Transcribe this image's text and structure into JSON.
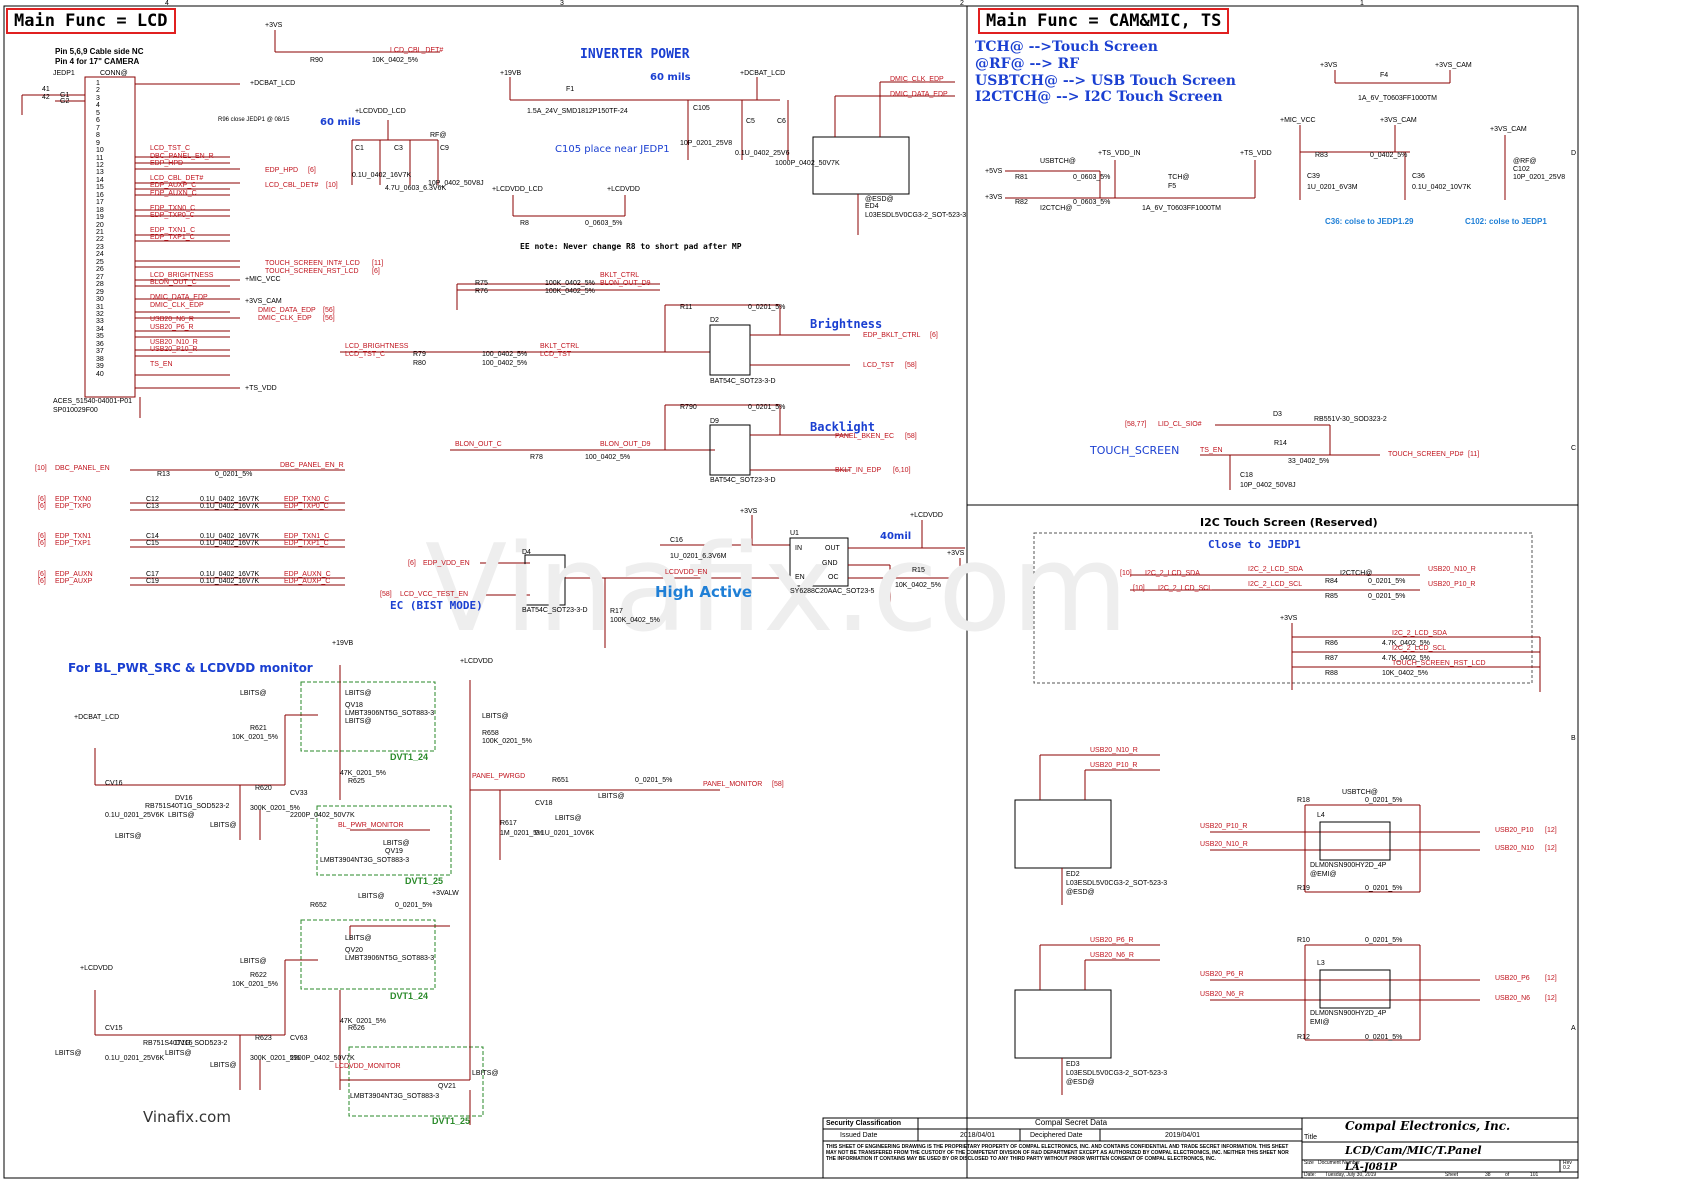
{
  "titles": {
    "lcd": "Main Func = LCD",
    "cam": "Main Func = CAM&MIC, TS"
  },
  "notes": {
    "pin_nc": "Pin 5,6,9 Cable side NC",
    "pin_cam": "Pin 4 for 17\" CAMERA",
    "inverter_power": "INVERTER POWER",
    "mils60a": "60 mils",
    "mils60b": "60 mils",
    "c105_note": "C105 place near JEDP1",
    "ee_note": "EE note: Never change R8 to short pad after MP",
    "r96_note": "R96 close JEDP1 @ 08/15",
    "brightness": "Brightness",
    "backlight": "Backlight",
    "high_active": "High Active",
    "ec_bist": "EC (BIST MODE)",
    "mil40": "40mil",
    "monitor": "For BL_PWR_SRC & LCDVDD monitor",
    "tch": "TCH@ -->Touch Screen",
    "rf": "@RF@ --> RF",
    "usbtch": "USBTCH@ --> USB Touch Screen",
    "i2ctch": "I2CTCH@ --> I2C Touch Screen",
    "touch_screen": "TOUCH_SCREEN",
    "i2c_title": "I2C Touch Screen (Reserved)",
    "close_jedp1": "Close to JEDP1",
    "c36_note": "C36: colse to JEDP1.29",
    "c102_note": "C102: colse to JEDP1",
    "vinafix_small": "Vinafix.com",
    "watermark": "Vinafix.com"
  },
  "connector": {
    "ref": "JEDP1",
    "conn": "CONN@",
    "part": "ACES_51540-04001-P01",
    "sp": "SP010029F00",
    "g1": "G1",
    "g2": "G2",
    "p41": "41",
    "p42": "42",
    "pins": [
      "1",
      "2",
      "3",
      "4",
      "5",
      "6",
      "7",
      "8",
      "9",
      "10",
      "11",
      "12",
      "13",
      "14",
      "15",
      "16",
      "17",
      "18",
      "19",
      "20",
      "21",
      "22",
      "23",
      "24",
      "25",
      "26",
      "27",
      "28",
      "29",
      "30",
      "31",
      "32",
      "33",
      "34",
      "35",
      "36",
      "37",
      "38",
      "39",
      "40"
    ],
    "nets": [
      "",
      "",
      "",
      "",
      "",
      "",
      "",
      "",
      "",
      "LCD_TST_C",
      "DBC_PANEL_EN_R",
      "EDP_HPD",
      "",
      "LCD_CBL_DET#",
      "EDP_AUXP_C",
      "EDP_AUXN_C",
      "",
      "EDP_TXN0_C",
      "EDP_TXP0_C",
      "",
      "EDP_TXN1_C",
      "EDP_TXP1_C",
      "",
      "",
      "",
      "",
      "LCD_BRIGHTNESS",
      "BLON_OUT_C",
      "",
      "DMIC_DATA_EDP",
      "DMIC_CLK_EDP",
      "",
      "USB20_N6_R",
      "USB20_P6_R",
      "",
      "USB20_N10_R",
      "USB20_P10_R",
      "",
      "TS_EN",
      ""
    ]
  },
  "left_side_labels": {
    "dcbat": "+DCBAT_LCD",
    "lcdvdd": "+LCDVDD_LCD",
    "rf": "RF@",
    "edp_hpd": "EDP_HPD",
    "edp_hpd_ref": "[6]",
    "lcd_cbl_det": "LCD_CBL_DET#",
    "lcd_cbl_det_ref": "[10]",
    "touch_int": "TOUCH_SCREEN_INT#_LCD",
    "touch_int_ref": "[11]",
    "touch_rst": "TOUCH_SCREEN_RST_LCD",
    "touch_rst_ref": "[6]",
    "mic_vcc": "+MIC_VCC",
    "vs_cam": "+3VS_CAM",
    "dmic_data": "DMIC_DATA_EDP",
    "dmic_data_ref": "[56]",
    "dmic_clk": "DMIC_CLK_EDP",
    "dmic_clk_ref": "[56]",
    "ts_vdd": "+TS_VDD"
  },
  "top_left": {
    "vs3": "+3VS",
    "r90": "R90",
    "r90_val": "10K_0402_5%",
    "lcd_cbl": "LCD_CBL_DET#"
  },
  "inverter": {
    "v19": "+19VB",
    "f1": "F1",
    "f1_val": "1.5A_24V_SMD1812P150TF-24",
    "dcbat": "+DCBAT_LCD",
    "c105": "C105",
    "c105_val": "10P_0201_25V8",
    "c5": "C5",
    "c5_val": "0.1U_0402_25V6",
    "c6": "C6",
    "c6_val": "1000P_0402_50V7K"
  },
  "lcdvdd_block": {
    "c1": "C1",
    "c1_val": "0.1U_0402_16V7K",
    "c3": "C3",
    "c3_val": "4.7U_0603_6.3V6K",
    "c9": "C9",
    "c9_val": "10P_0402_50V8J",
    "r8_from": "+LCDVDD_LCD",
    "r8_to": "+LCDVDD",
    "r8": "R8",
    "r8_val": "0_0603_5%"
  },
  "dmic": {
    "clk": "DMIC_CLK_EDP",
    "data": "DMIC_DATA_EDP",
    "ed4": "ED4",
    "ed4_val": "L03ESDL5V0CG3-2_SOT-523-3",
    "esd": "@ESD@"
  },
  "brightness_block": {
    "r75": "R75",
    "r76": "R76",
    "r75_val": "100K_0402_5%",
    "r76_val": "100K_0402_5%",
    "bklt_ctrl": "BKLT_CTRL",
    "blon_out_d9": "BLON_OUT_D9",
    "r11": "R11",
    "r11_val": "0_0201_5%",
    "d2": "D2",
    "d2_val": "BAT54C_SOT23-3-D",
    "lcd_brightness": "LCD_BRIGHTNESS",
    "lcd_tst_c": "LCD_TST_C",
    "r79": "R79",
    "r80": "R80",
    "r79_val": "100_0402_5%",
    "r80_val": "100_0402_5%",
    "bklt_ctrl2": "BKLT_CTRL",
    "lcd_tst": "LCD_TST",
    "edp_bklt": "EDP_BKLT_CTRL",
    "edp_bklt_ref": "[6]",
    "lcd_tst_out": "LCD_TST",
    "lcd_tst_ref": "[58]"
  },
  "backlight_block": {
    "r790": "R790",
    "r790_val": "0_0201_5%",
    "d9": "D9",
    "d9_val": "BAT54C_SOT23-3-D",
    "blon_out_c": "BLON_OUT_C",
    "r78": "R78",
    "r78_val": "100_0402_5%",
    "blon_out_d9": "BLON_OUT_D9",
    "panel_bken": "PANEL_BKEN_EC",
    "panel_bken_ref": "[58]",
    "bklt_in": "BKLT_IN_EDP",
    "bklt_in_ref": "[6,10]"
  },
  "dbc": {
    "ref": "[10]",
    "net": "DBC_PANEL_EN",
    "r13": "R13",
    "r13_val": "0_0201_5%",
    "out": "DBC_PANEL_EN_R"
  },
  "ac_caps": [
    {
      "ref": "[6]",
      "in": "EDP_TXN0",
      "c": "C12",
      "val": "0.1U_0402_16V7K",
      "out": "EDP_TXN0_C"
    },
    {
      "ref": "[6]",
      "in": "EDP_TXP0",
      "c": "C13",
      "val": "0.1U_0402_16V7K",
      "out": "EDP_TXP0_C"
    },
    {
      "ref": "[6]",
      "in": "EDP_TXN1",
      "c": "C14",
      "val": "0.1U_0402_16V7K",
      "out": "EDP_TXN1_C"
    },
    {
      "ref": "[6]",
      "in": "EDP_TXP1",
      "c": "C15",
      "val": "0.1U_0402_16V7K",
      "out": "EDP_TXP1_C"
    },
    {
      "ref": "[6]",
      "in": "EDP_AUXN",
      "c": "C17",
      "val": "0.1U_0402_16V7K",
      "out": "EDP_AUXN_C"
    },
    {
      "ref": "[6]",
      "in": "EDP_AUXP",
      "c": "C19",
      "val": "0.1U_0402_16V7K",
      "out": "EDP_AUXP_C"
    }
  ],
  "bist": {
    "edp_vdd_en": "EDP_VDD_EN",
    "edp_ref": "[6]",
    "lcd_vcc_test": "LCD_VCC_TEST_EN",
    "lcd_ref": "[58]",
    "d4": "D4",
    "d4_val": "BAT54C_SOT23-3-D",
    "lcdvdd_en": "LCDVDD_EN",
    "r17": "R17",
    "r17_val": "100K_0402_5%",
    "vs3": "+3VS",
    "c16": "C16",
    "c16_val": "1U_0201_6.3V6M",
    "u1": "U1",
    "u1_val": "SY6288C20AAC_SOT23-5",
    "pin_in": "IN",
    "pin_gnd": "GND",
    "pin_en": "EN",
    "pin_out": "OUT",
    "pin_oc": "OC",
    "lcdvdd": "+LCDVDD",
    "r15": "R15",
    "r15_val": "10K_0402_5%",
    "vs3b": "+3VS"
  },
  "monitor_block": {
    "v19": "+19VB",
    "lcdvdd": "+LCDVDD",
    "dcbat": "+DCBAT_LCD",
    "lbits": "LBITS@",
    "qv18": "QV18",
    "qv18_val": "LMBT3906NT5G_SOT883-3",
    "r621": "R621",
    "r621_val": "10K_0201_5%",
    "dv16": "DV16",
    "dv16_val": "RB751S40T1G_SOD523-2",
    "cv16": "CV16",
    "cv16_val": "0.1U_0201_25V6K",
    "r620": "R620",
    "r620_val": "300K_0201_5%",
    "cv33": "CV33",
    "cv33_val": "2200P_0402_50V7K",
    "r625": "R625",
    "r625_val": "47K_0201_5%",
    "bl_pwr_monitor": "BL_PWR_MONITOR",
    "qv19": "QV19",
    "qv19_val": "LMBT3904NT3G_SOT883-3",
    "dvt1_24": "DVT1_24",
    "dvt1_25": "DVT1_25",
    "r658": "R658",
    "r658_val": "100K_0201_5%",
    "panel_pwrgd": "PANEL_PWRGD",
    "r651": "R651",
    "r651_val": "0_0201_5%",
    "panel_monitor": "PANEL_MONITOR",
    "panel_ref": "[58]",
    "r617": "R617",
    "r617_val": "1M_0201_5%",
    "cv18": "CV18",
    "cv18_val": "0.1U_0201_10V6K",
    "valw": "+3VALW",
    "r652": "R652",
    "r652_val": "0_0201_5%",
    "qv20": "QV20",
    "qv20_val": "LMBT3906NT5G_SOT883-3",
    "r622": "R622",
    "r622_val": "10K_0201_5%",
    "dv15": "DV15",
    "dv15_val": "RB751S40T1G_SOD523-2",
    "cv15": "CV15",
    "cv15_val": "0.1U_0201_25V6K",
    "r623": "R623",
    "r623_val": "300K_0201_5%",
    "cv63": "CV63",
    "cv63_val": "2200P_0402_50V7K",
    "r626": "R626",
    "r626_val": "47K_0201_5%",
    "lcdvdd_monitor": "LCDVDD_MONITOR",
    "qv21": "QV21",
    "qv21_val": "LMBT3904NT3G_SOT883-3",
    "lcdvdd2": "+LCDVDD"
  },
  "cam_block": {
    "vs3": "+3VS",
    "f4": "F4",
    "f4_val": "1A_6V_T0603FF1000TM",
    "vs3_cam": "+3VS_CAM",
    "usbtch": "USBTCH@",
    "ts_vdd_in": "+TS_VDD_IN",
    "ts_vdd": "+TS_VDD",
    "v5vs": "+5VS",
    "r81": "R81",
    "r81_val": "0_0603_5%",
    "v3vs": "+3VS",
    "r82": "R82",
    "r82_val": "0_0603_5%",
    "i2ctch": "I2CTCH@",
    "tch": "TCH@",
    "f5": "F5",
    "f5_val": "1A_6V_T0603FF1000TM",
    "mic_vcc": "+MIC_VCC",
    "vs3_cam2": "+3VS_CAM",
    "r83": "R83",
    "r83_val": "0_0402_5%",
    "c39": "C39",
    "c39_val": "1U_0201_6V3M",
    "c36": "C36",
    "c36_val": "0.1U_0402_10V7K",
    "vs3_cam3": "+3VS_CAM",
    "rf": "@RF@",
    "c102": "C102",
    "c102_val": "10P_0201_25V8"
  },
  "touch_block": {
    "lid_ref": "[58,77]",
    "lid": "LID_CL_SIO#",
    "d3": "D3",
    "d3_val": "RB551V-30_SOD323-2",
    "r14": "R14",
    "r14_val": "33_0402_5%",
    "ts_en": "TS_EN",
    "c18": "C18",
    "c18_val": "10P_0402_50V8J",
    "touch_pd": "TOUCH_SCREEN_PD#",
    "touch_ref": "[11]"
  },
  "i2c_block": {
    "ref1": "[10]",
    "sda": "I2C_2_LCD_SDA",
    "ref2": "[10]",
    "scl": "I2C_2_LCD_SCL",
    "sda_r": "I2C_2_LCD_SDA",
    "scl_r": "I2C_2_LCD_SCL",
    "r84": "R84",
    "r84_val": "0_0201_5%",
    "r85": "R85",
    "r85_val": "0_0201_5%",
    "usb_n10": "USB20_N10_R",
    "usb_p10": "USB20_P10_R",
    "vs3": "+3VS",
    "r86": "R86",
    "r86_val": "4.7K_0402_5%",
    "r87": "R87",
    "r87_val": "4.7K_0402_5%",
    "r88": "R88",
    "r88_val": "10K_0402_5%",
    "sda2": "I2C_2_LCD_SDA",
    "scl2": "I2C_2_LCD_SCL",
    "rst": "TOUCH_SCREEN_RST_LCD",
    "i2ctch": "I2CTCH@"
  },
  "usb_block": {
    "n10_r": "USB20_N10_R",
    "p10_r": "USB20_P10_R",
    "ed2": "ED2",
    "ed2_val": "L03ESDL5V0CG3-2_SOT-523-3",
    "esd": "@ESD@",
    "r18": "R18",
    "r18_val": "0_0201_5%",
    "usbtch": "USBTCH@",
    "l4": "L4",
    "l4_val": "DLM0NSN900HY2D_4P",
    "emi": "@EMI@",
    "r19": "R19",
    "r19_val": "0_0201_5%",
    "p10_in": "USB20_P10_R",
    "n10_in": "USB20_N10_R",
    "p10_out": "USB20_P10",
    "n10_out": "USB20_N10",
    "ref12": "[12]",
    "p6_r": "USB20_P6_R",
    "n6_r": "USB20_N6_R",
    "ed3": "ED3",
    "ed3_val": "L03ESDL5V0CG3-2_SOT-523-3",
    "r10": "R10",
    "r10_val": "0_0201_5%",
    "l3": "L3",
    "l3_val": "DLM0NSN900HY2D_4P",
    "emi2": "EMI@",
    "r12": "R12",
    "r12_val": "0_0201_5%",
    "p6_in": "USB20_P6_R",
    "n6_in": "USB20_N6_R",
    "p6_out": "USB20_P6",
    "n6_out": "USB20_N6"
  },
  "title_block": {
    "security": "Security Classification",
    "secret": "Compal Secret Data",
    "issued": "Issued Date",
    "issued_date": "2018/04/01",
    "deciphered": "Deciphered Date",
    "deciphered_date": "2019/04/01",
    "legal": "THIS SHEET OF ENGINEERING DRAWING IS THE PROPRIETARY PROPERTY OF COMPAL ELECTRONICS, INC. AND CONTAINS CONFIDENTIAL AND TRADE SECRET INFORMATION. THIS SHEET MAY NOT BE TRANSFERED FROM THE CUSTODY OF THE COMPETENT DIVISION OF R&D DEPARTMENT EXCEPT AS AUTHORIZED BY COMPAL ELECTRONICS, INC. NEITHER THIS SHEET NOR THE INFORMATION IT CONTAINS MAY BE USED BY OR DISCLOSED TO ANY THIRD PARTY WITHOUT PRIOR WRITTEN CONSENT OF COMPAL ELECTRONICS, INC.",
    "company": "Compal Electronics, Inc.",
    "title_lbl": "Title",
    "title": "LCD/Cam/MIC/T.Panel",
    "size": "Size",
    "doc_lbl": "Document Number",
    "doc": "LA-J081P",
    "rev_lbl": "Rev",
    "rev": "0.2",
    "date_lbl": "Date:",
    "date": "Tuesday, July 30, 2019",
    "sheet_lbl": "Sheet",
    "sheet": "38",
    "of": "of",
    "total": "101"
  },
  "border": {
    "cols": [
      "4",
      "3",
      "2",
      "1"
    ],
    "rows": [
      "D",
      "C",
      "B",
      "A"
    ]
  }
}
